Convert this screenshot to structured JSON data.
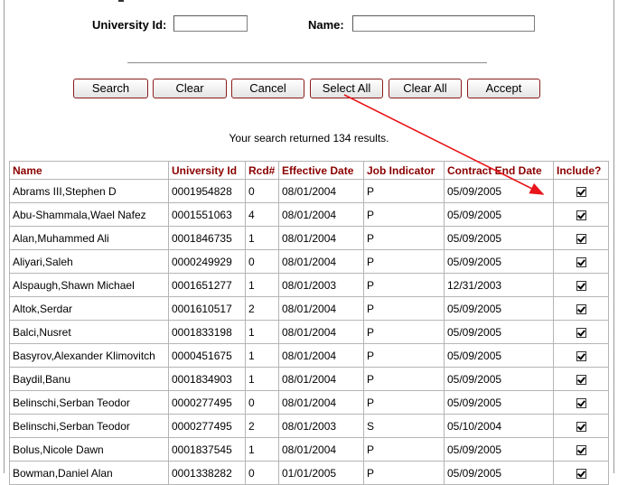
{
  "search": {
    "university_id_label": "University Id:",
    "university_id_value": "",
    "name_label": "Name:",
    "name_value": ""
  },
  "buttons": {
    "search": "Search",
    "clear": "Clear",
    "cancel": "Cancel",
    "select_all": "Select All",
    "clear_all": "Clear All",
    "accept": "Accept"
  },
  "results_text": "Your search returned 134 results.",
  "table": {
    "headers": [
      "Name",
      "University Id",
      "Rcd#",
      "Effective Date",
      "Job Indicator",
      "Contract End Date",
      "Include?"
    ],
    "rows": [
      {
        "name": "Abrams III,Stephen D",
        "id": "0001954828",
        "rcd": "0",
        "eff": "08/01/2004",
        "job": "P",
        "end": "05/09/2005",
        "include": true
      },
      {
        "name": "Abu-Shammala,Wael Nafez",
        "id": "0001551063",
        "rcd": "4",
        "eff": "08/01/2004",
        "job": "P",
        "end": "05/09/2005",
        "include": true
      },
      {
        "name": "Alan,Muhammed Ali",
        "id": "0001846735",
        "rcd": "1",
        "eff": "08/01/2004",
        "job": "P",
        "end": "05/09/2005",
        "include": true
      },
      {
        "name": "Aliyari,Saleh",
        "id": "0000249929",
        "rcd": "0",
        "eff": "08/01/2004",
        "job": "P",
        "end": "05/09/2005",
        "include": true
      },
      {
        "name": "Alspaugh,Shawn Michael",
        "id": "0001651277",
        "rcd": "1",
        "eff": "08/01/2003",
        "job": "P",
        "end": "12/31/2003",
        "include": true
      },
      {
        "name": "Altok,Serdar",
        "id": "0001610517",
        "rcd": "2",
        "eff": "08/01/2004",
        "job": "P",
        "end": "05/09/2005",
        "include": true
      },
      {
        "name": "Balci,Nusret",
        "id": "0001833198",
        "rcd": "1",
        "eff": "08/01/2004",
        "job": "P",
        "end": "05/09/2005",
        "include": true
      },
      {
        "name": "Basyrov,Alexander Klimovitch",
        "id": "0000451675",
        "rcd": "1",
        "eff": "08/01/2004",
        "job": "P",
        "end": "05/09/2005",
        "include": true
      },
      {
        "name": "Baydil,Banu",
        "id": "0001834903",
        "rcd": "1",
        "eff": "08/01/2004",
        "job": "P",
        "end": "05/09/2005",
        "include": true
      },
      {
        "name": "Belinschi,Serban Teodor",
        "id": "0000277495",
        "rcd": "0",
        "eff": "08/01/2004",
        "job": "P",
        "end": "05/09/2005",
        "include": true
      },
      {
        "name": "Belinschi,Serban Teodor",
        "id": "0000277495",
        "rcd": "2",
        "eff": "08/01/2003",
        "job": "S",
        "end": "05/10/2004",
        "include": true
      },
      {
        "name": "Bolus,Nicole Dawn",
        "id": "0001837545",
        "rcd": "1",
        "eff": "08/01/2004",
        "job": "P",
        "end": "05/09/2005",
        "include": true
      },
      {
        "name": "Bowman,Daniel Alan",
        "id": "0001338282",
        "rcd": "0",
        "eff": "01/01/2005",
        "job": "P",
        "end": "05/09/2005",
        "include": true
      }
    ]
  },
  "colors": {
    "header_text": "#8b0000",
    "button_border": "#8b1a1a",
    "arrow": "#e8141b"
  }
}
